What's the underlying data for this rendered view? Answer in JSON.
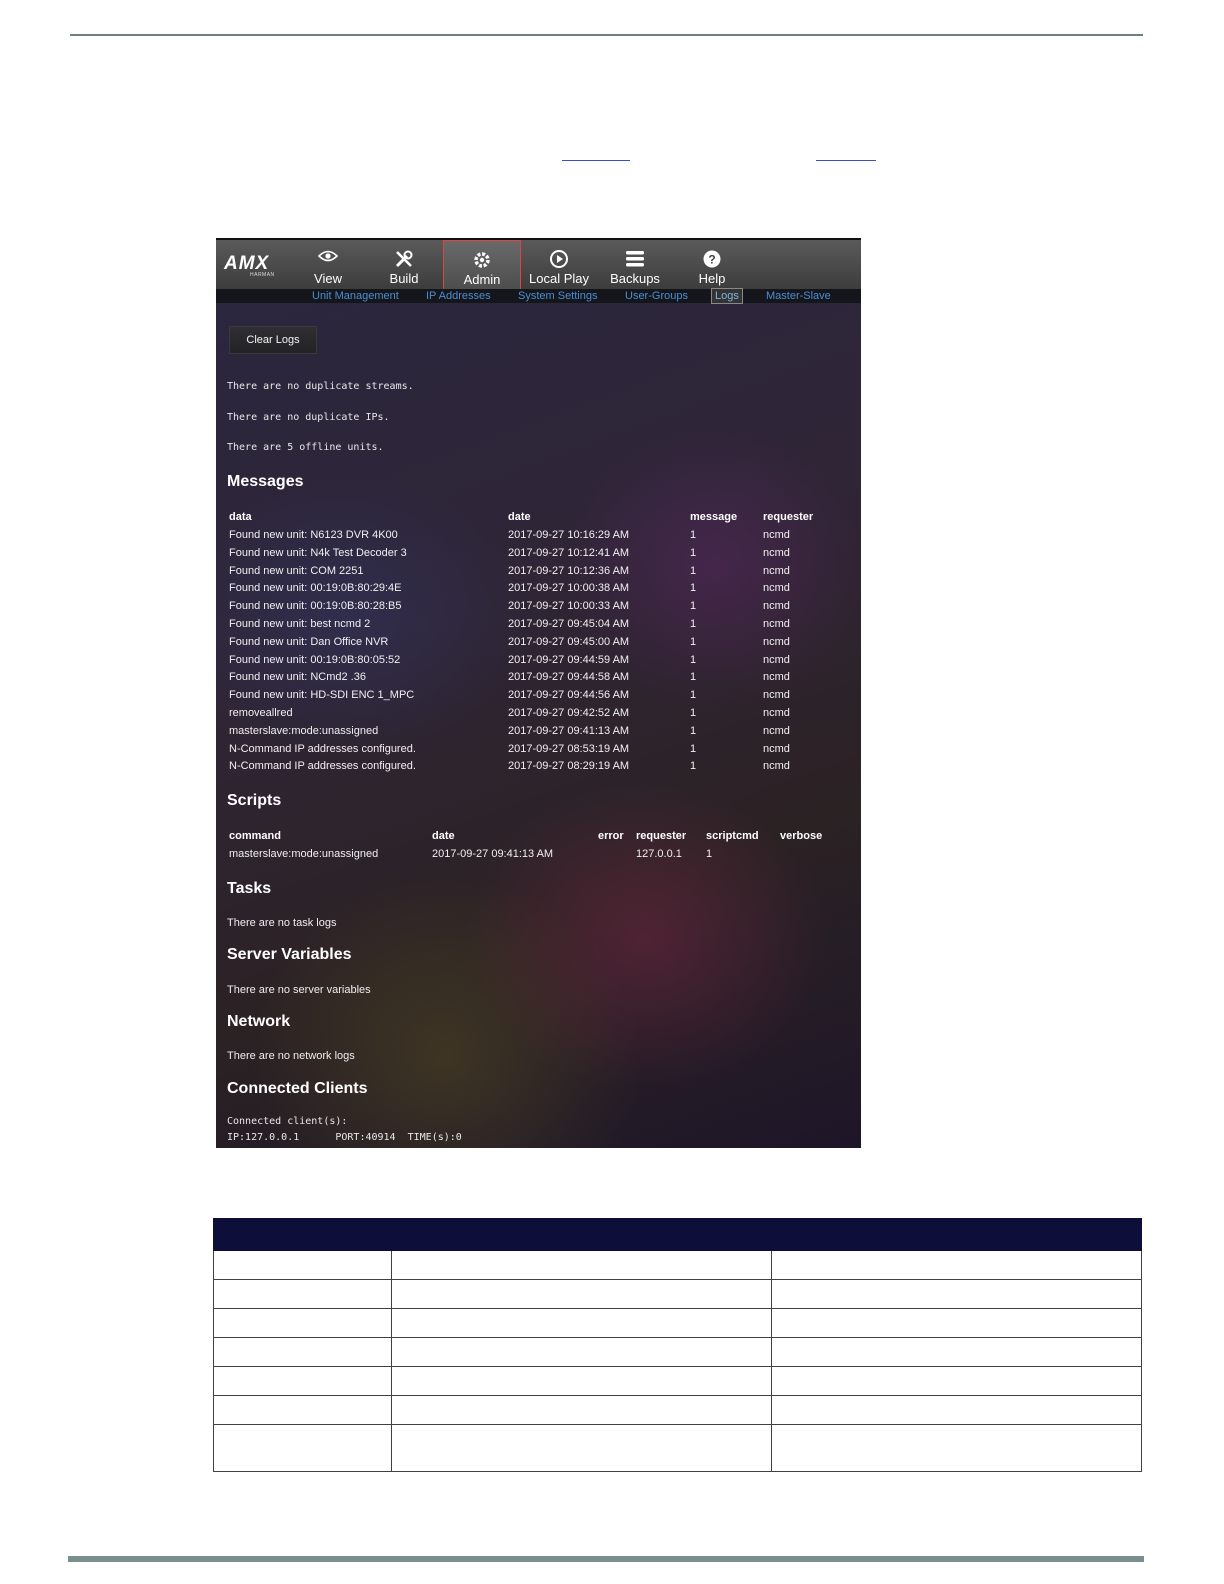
{
  "app": {
    "logo": "AMX",
    "logo_sub": "HARMAN",
    "nav": [
      {
        "label": "View",
        "icon": "eye-icon"
      },
      {
        "label": "Build",
        "icon": "tools-icon"
      },
      {
        "label": "Admin",
        "icon": "gear-icon",
        "active": true
      },
      {
        "label": "Local Play",
        "icon": "play-circle-icon"
      },
      {
        "label": "Backups",
        "icon": "stack-icon"
      },
      {
        "label": "Help",
        "icon": "help-icon"
      }
    ],
    "subnav": [
      {
        "label": "Unit Management"
      },
      {
        "label": "IP Addresses"
      },
      {
        "label": "System Settings"
      },
      {
        "label": "User-Groups"
      },
      {
        "label": "Logs",
        "active": true
      },
      {
        "label": "Master-Slave"
      }
    ],
    "clear_logs_label": "Clear Logs",
    "status_lines": [
      "There are no duplicate streams.",
      "There are no duplicate IPs.",
      "There are 5 offline units."
    ],
    "messages": {
      "heading": "Messages",
      "columns": [
        "data",
        "date",
        "message",
        "requester"
      ],
      "rows": [
        [
          "Found new unit: N6123 DVR 4K00",
          "2017-09-27 10:16:29 AM",
          "1",
          "ncmd"
        ],
        [
          "Found new unit: N4k Test Decoder 3",
          "2017-09-27 10:12:41 AM",
          "1",
          "ncmd"
        ],
        [
          "Found new unit: COM 2251",
          "2017-09-27 10:12:36 AM",
          "1",
          "ncmd"
        ],
        [
          "Found new unit: 00:19:0B:80:29:4E",
          "2017-09-27 10:00:38 AM",
          "1",
          "ncmd"
        ],
        [
          "Found new unit: 00:19:0B:80:28:B5",
          "2017-09-27 10:00:33 AM",
          "1",
          "ncmd"
        ],
        [
          "Found new unit: best ncmd 2",
          "2017-09-27 09:45:04 AM",
          "1",
          "ncmd"
        ],
        [
          "Found new unit: Dan Office NVR",
          "2017-09-27 09:45:00 AM",
          "1",
          "ncmd"
        ],
        [
          "Found new unit: 00:19:0B:80:05:52",
          "2017-09-27 09:44:59 AM",
          "1",
          "ncmd"
        ],
        [
          "Found new unit: NCmd2 .36",
          "2017-09-27 09:44:58 AM",
          "1",
          "ncmd"
        ],
        [
          "Found new unit: HD-SDI ENC 1_MPC",
          "2017-09-27 09:44:56 AM",
          "1",
          "ncmd"
        ],
        [
          "removeallred",
          "2017-09-27 09:42:52 AM",
          "1",
          "ncmd"
        ],
        [
          "masterslave:mode:unassigned",
          "2017-09-27 09:41:13 AM",
          "1",
          "ncmd"
        ],
        [
          "N-Command IP addresses configured.",
          "2017-09-27 08:53:19 AM",
          "1",
          "ncmd"
        ],
        [
          "N-Command IP addresses configured.",
          "2017-09-27 08:29:19 AM",
          "1",
          "ncmd"
        ]
      ]
    },
    "scripts": {
      "heading": "Scripts",
      "columns": [
        "command",
        "date",
        "error",
        "requester",
        "scriptcmd",
        "verbose"
      ],
      "rows": [
        [
          "masterslave:mode:unassigned",
          "2017-09-27 09:41:13 AM",
          "",
          "127.0.0.1",
          "1",
          ""
        ]
      ]
    },
    "tasks": {
      "heading": "Tasks",
      "text": "There are no task logs"
    },
    "server_variables": {
      "heading": "Server Variables",
      "text": "There are no server variables"
    },
    "network": {
      "heading": "Network",
      "text": "There are no network logs"
    },
    "connected_clients": {
      "heading": "Connected Clients",
      "line1": "Connected client(s):",
      "line2": "IP:127.0.0.1      PORT:40914  TIME(s):0"
    }
  }
}
